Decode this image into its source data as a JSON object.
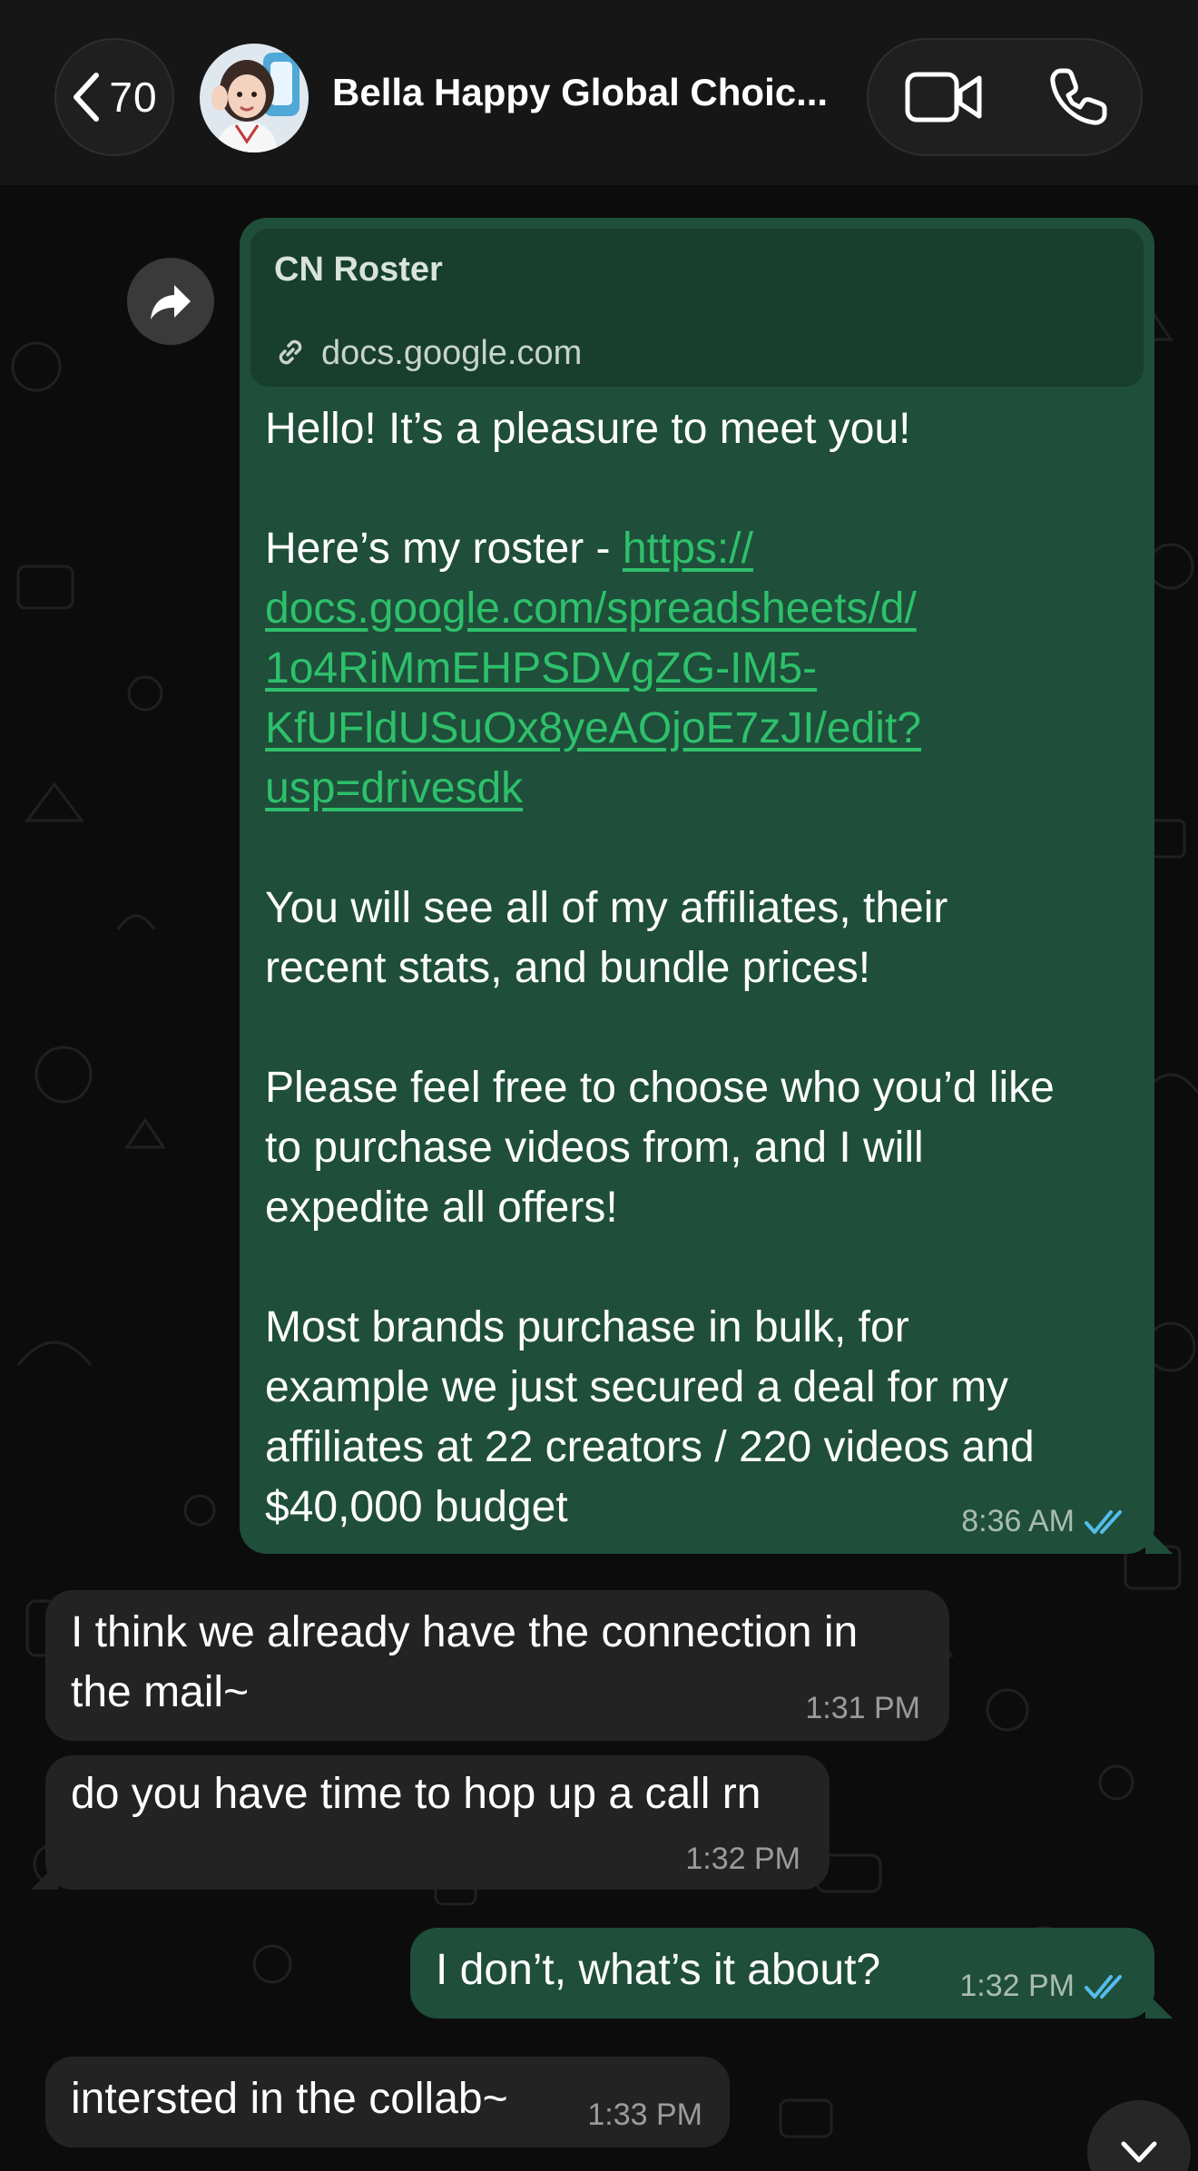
{
  "header": {
    "back_count": "70",
    "chat_title": "Bella Happy Global Choic...",
    "icons": {
      "back": "chevron-left-icon",
      "video": "video-camera-icon",
      "call": "phone-icon"
    }
  },
  "messages": [
    {
      "direction": "outgoing",
      "preview": {
        "title": "CN Roster",
        "domain": "docs.google.com"
      },
      "text_before_link": "Hello! It’s a pleasure to meet you!\n\nHere’s my roster - ",
      "link_lines": [
        "https://",
        "docs.google.com/spreadsheets/d/",
        "1o4RiMmEHPSDVgZG-IM5-",
        "KfUFldUSuOx8yeAOjoE7zJI/edit?",
        "usp=drivesdk"
      ],
      "text_after_link": "You will see all of my affiliates, their\nrecent stats, and bundle prices!\n\nPlease feel free to choose who you’d like\nto purchase videos from, and I will\nexpedite all offers!\n\nMost brands purchase in bulk, for\nexample we just secured a deal for my\naffiliates at 22 creators / 220 videos and\n$40,000 budget",
      "time": "8:36 AM",
      "status": "read"
    },
    {
      "direction": "incoming",
      "text": "I think we already have the connection in\nthe mail~",
      "time": "1:31 PM"
    },
    {
      "direction": "incoming",
      "text": "do you have time to hop up a call rn",
      "time": "1:32 PM"
    },
    {
      "direction": "outgoing",
      "text": "I don’t, what’s it about?",
      "time": "1:32 PM",
      "status": "read"
    },
    {
      "direction": "incoming",
      "text": "intersted in the collab~",
      "time": "1:33 PM"
    }
  ],
  "colors": {
    "outgoing_bubble": "#1f4e3a",
    "incoming_bubble": "#232323",
    "link": "#2ec06b",
    "read_ticks": "#53bdeb"
  }
}
